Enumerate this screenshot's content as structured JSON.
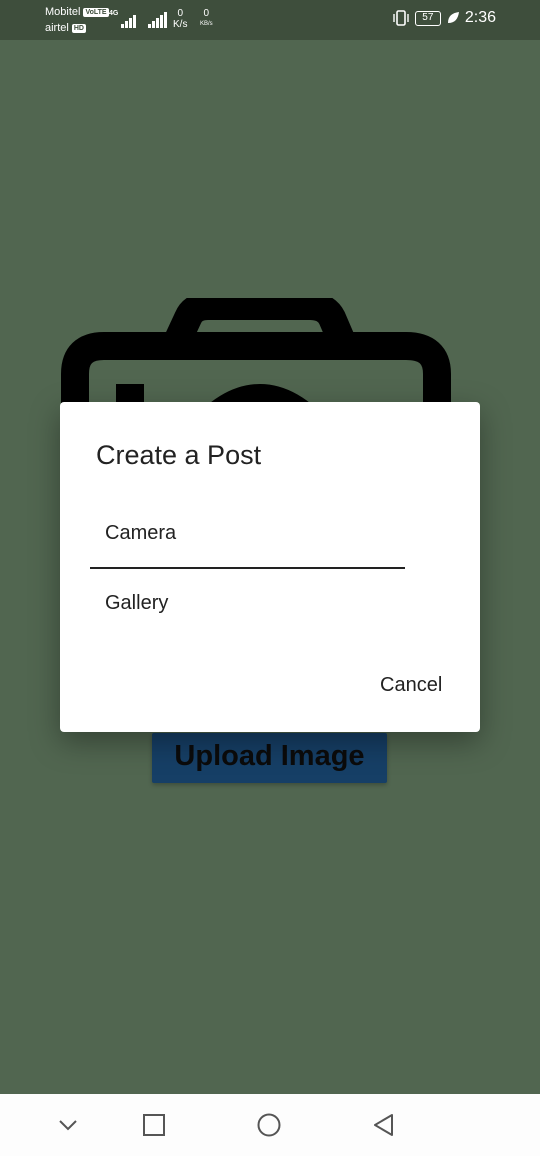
{
  "status_bar": {
    "carrier_1": "Mobitel",
    "carrier_1_badge": "VoLTE",
    "carrier_2": "airtel",
    "carrier_2_badge": "HD",
    "network_type": "4G",
    "speed_up_value": "0",
    "speed_up_unit": "K/s",
    "speed_down_value": "0",
    "speed_down_unit": "KB/s",
    "battery": "57",
    "time": "2:36"
  },
  "background": {
    "upload_button_label": "Upload Image"
  },
  "dialog": {
    "title": "Create a Post",
    "options": [
      "Camera",
      "Gallery"
    ],
    "cancel_label": "Cancel"
  },
  "nav_bar": {
    "icons": [
      "chevron-down-icon",
      "recent-apps-icon",
      "home-icon",
      "back-icon"
    ]
  },
  "colors": {
    "background": "#516650",
    "status_bar": "#3e4e3c",
    "upload_button": "#163f66",
    "dialog": "#ffffff"
  }
}
